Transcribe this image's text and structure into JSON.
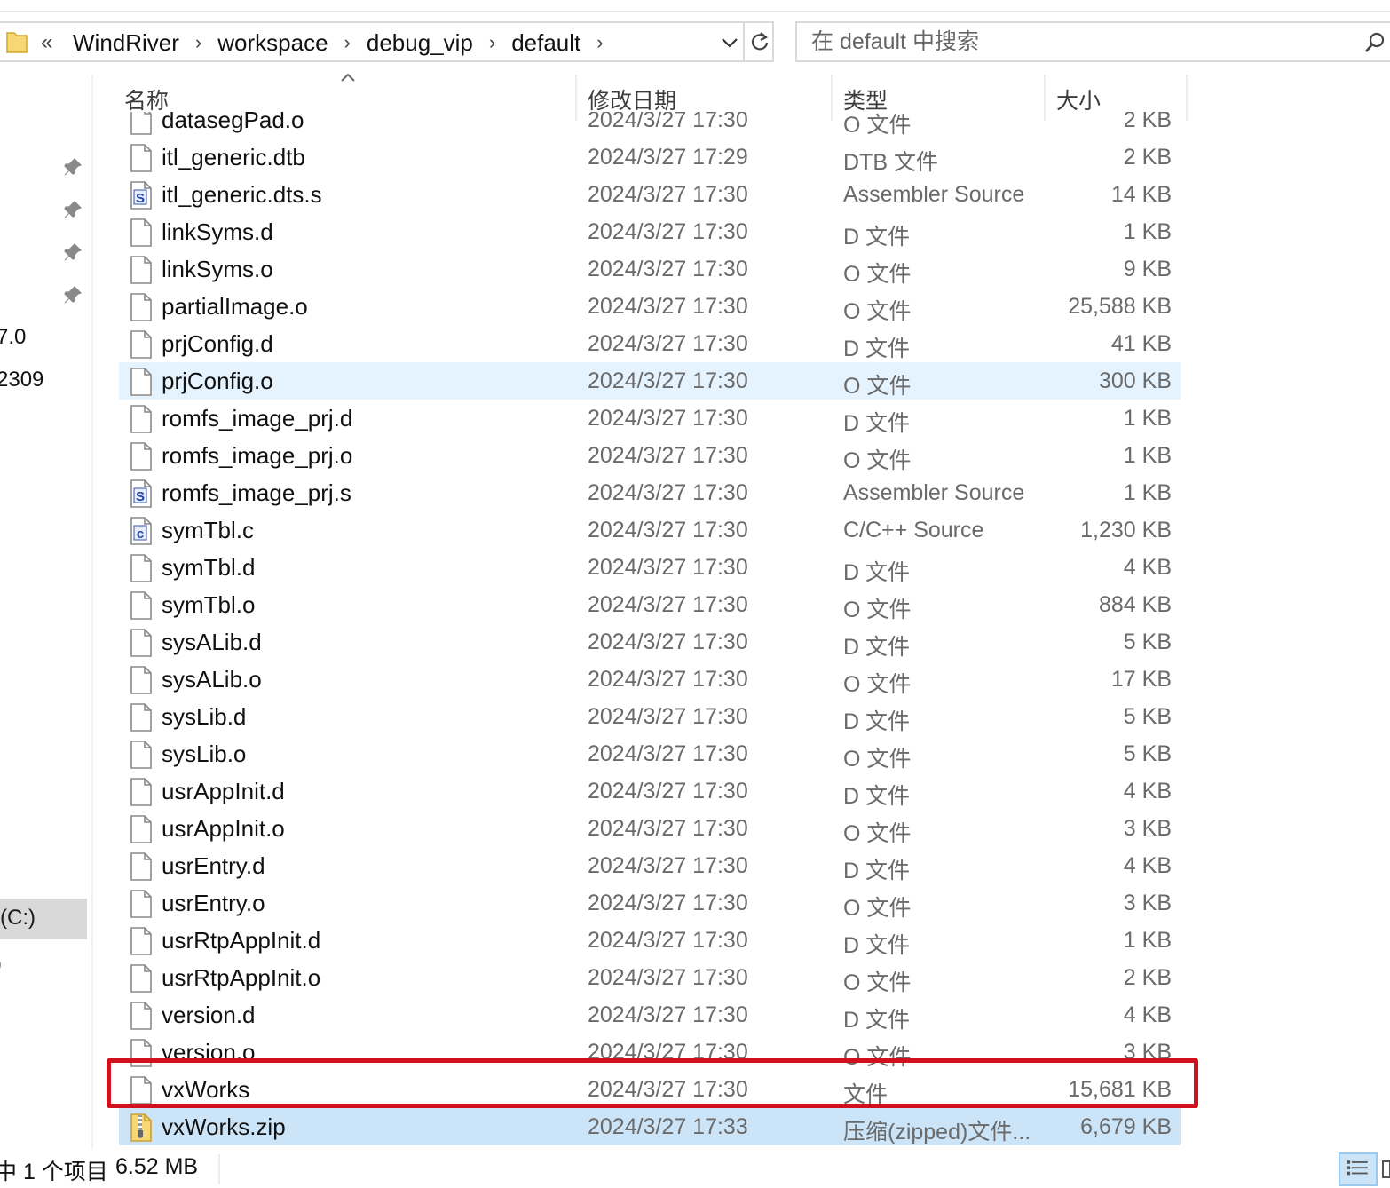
{
  "address": {
    "overflow_chevrons": "«",
    "crumbs": [
      "WindRiver",
      "workspace",
      "debug_vip",
      "default"
    ],
    "separator": "›"
  },
  "search": {
    "placeholder": "在 default 中搜索"
  },
  "nav": {
    "items": [
      {
        "label": "7.0"
      },
      {
        "label": "2309"
      },
      {
        "label": "(C:)",
        "selected": true
      },
      {
        "label": ")"
      }
    ]
  },
  "columns": {
    "name": "名称",
    "date": "修改日期",
    "type": "类型",
    "size": "大小"
  },
  "files": [
    {
      "name": "datasegPad.o",
      "date": "2024/3/27 17:30",
      "type": "O 文件",
      "size": "2 KB",
      "icon": "blank-file-icon"
    },
    {
      "name": "itl_generic.dtb",
      "date": "2024/3/27 17:29",
      "type": "DTB 文件",
      "size": "2 KB",
      "icon": "blank-file-icon"
    },
    {
      "name": "itl_generic.dts.s",
      "date": "2024/3/27 17:30",
      "type": "Assembler Source",
      "size": "14 KB",
      "icon": "assembler-file-icon"
    },
    {
      "name": "linkSyms.d",
      "date": "2024/3/27 17:30",
      "type": "D 文件",
      "size": "1 KB",
      "icon": "blank-file-icon"
    },
    {
      "name": "linkSyms.o",
      "date": "2024/3/27 17:30",
      "type": "O 文件",
      "size": "9 KB",
      "icon": "blank-file-icon"
    },
    {
      "name": "partialImage.o",
      "date": "2024/3/27 17:30",
      "type": "O 文件",
      "size": "25,588 KB",
      "icon": "blank-file-icon"
    },
    {
      "name": "prjConfig.d",
      "date": "2024/3/27 17:30",
      "type": "D 文件",
      "size": "41 KB",
      "icon": "blank-file-icon"
    },
    {
      "name": "prjConfig.o",
      "date": "2024/3/27 17:30",
      "type": "O 文件",
      "size": "300 KB",
      "icon": "blank-file-icon",
      "hover": true
    },
    {
      "name": "romfs_image_prj.d",
      "date": "2024/3/27 17:30",
      "type": "D 文件",
      "size": "1 KB",
      "icon": "blank-file-icon"
    },
    {
      "name": "romfs_image_prj.o",
      "date": "2024/3/27 17:30",
      "type": "O 文件",
      "size": "1 KB",
      "icon": "blank-file-icon"
    },
    {
      "name": "romfs_image_prj.s",
      "date": "2024/3/27 17:30",
      "type": "Assembler Source",
      "size": "1 KB",
      "icon": "assembler-file-icon"
    },
    {
      "name": "symTbl.c",
      "date": "2024/3/27 17:30",
      "type": "C/C++ Source",
      "size": "1,230 KB",
      "icon": "c-source-file-icon"
    },
    {
      "name": "symTbl.d",
      "date": "2024/3/27 17:30",
      "type": "D 文件",
      "size": "4 KB",
      "icon": "blank-file-icon"
    },
    {
      "name": "symTbl.o",
      "date": "2024/3/27 17:30",
      "type": "O 文件",
      "size": "884 KB",
      "icon": "blank-file-icon"
    },
    {
      "name": "sysALib.d",
      "date": "2024/3/27 17:30",
      "type": "D 文件",
      "size": "5 KB",
      "icon": "blank-file-icon"
    },
    {
      "name": "sysALib.o",
      "date": "2024/3/27 17:30",
      "type": "O 文件",
      "size": "17 KB",
      "icon": "blank-file-icon"
    },
    {
      "name": "sysLib.d",
      "date": "2024/3/27 17:30",
      "type": "D 文件",
      "size": "5 KB",
      "icon": "blank-file-icon"
    },
    {
      "name": "sysLib.o",
      "date": "2024/3/27 17:30",
      "type": "O 文件",
      "size": "5 KB",
      "icon": "blank-file-icon"
    },
    {
      "name": "usrAppInit.d",
      "date": "2024/3/27 17:30",
      "type": "D 文件",
      "size": "4 KB",
      "icon": "blank-file-icon"
    },
    {
      "name": "usrAppInit.o",
      "date": "2024/3/27 17:30",
      "type": "O 文件",
      "size": "3 KB",
      "icon": "blank-file-icon"
    },
    {
      "name": "usrEntry.d",
      "date": "2024/3/27 17:30",
      "type": "D 文件",
      "size": "4 KB",
      "icon": "blank-file-icon"
    },
    {
      "name": "usrEntry.o",
      "date": "2024/3/27 17:30",
      "type": "O 文件",
      "size": "3 KB",
      "icon": "blank-file-icon"
    },
    {
      "name": "usrRtpAppInit.d",
      "date": "2024/3/27 17:30",
      "type": "D 文件",
      "size": "1 KB",
      "icon": "blank-file-icon"
    },
    {
      "name": "usrRtpAppInit.o",
      "date": "2024/3/27 17:30",
      "type": "O 文件",
      "size": "2 KB",
      "icon": "blank-file-icon"
    },
    {
      "name": "version.d",
      "date": "2024/3/27 17:30",
      "type": "D 文件",
      "size": "4 KB",
      "icon": "blank-file-icon"
    },
    {
      "name": "version.o",
      "date": "2024/3/27 17:30",
      "type": "O 文件",
      "size": "3 KB",
      "icon": "blank-file-icon"
    },
    {
      "name": "vxWorks",
      "date": "2024/3/27 17:30",
      "type": "文件",
      "size": "15,681 KB",
      "icon": "blank-file-icon",
      "annotated": true
    },
    {
      "name": "vxWorks.zip",
      "date": "2024/3/27 17:33",
      "type": "压缩(zipped)文件...",
      "size": "6,679 KB",
      "icon": "zip-file-icon",
      "selected": true
    }
  ],
  "status": {
    "selection": "中 1 个项目",
    "size": "6.52 MB"
  },
  "colors": {
    "selected": "#cce4f7",
    "hover": "#e5f3ff",
    "annotation": "#d1101c"
  }
}
